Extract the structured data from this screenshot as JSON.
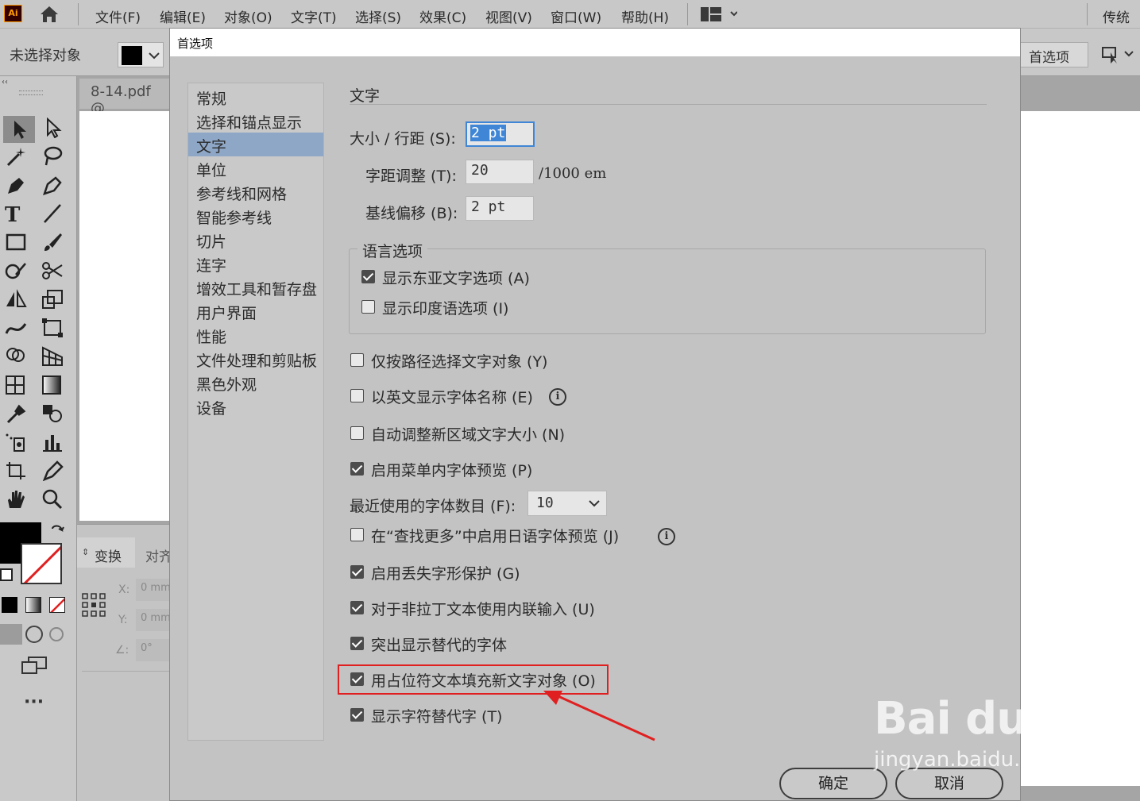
{
  "app": {
    "logo_text": "Ai",
    "menus": [
      "文件(F)",
      "编辑(E)",
      "对象(O)",
      "文字(T)",
      "选择(S)",
      "效果(C)",
      "视图(V)",
      "窗口(W)",
      "帮助(H)"
    ],
    "workspace": "传统基"
  },
  "control_bar": {
    "no_selection": "未选择对象",
    "prefs_button": "首选项"
  },
  "document": {
    "tab": "8-14.pdf @"
  },
  "panel": {
    "tab_transform": "变换",
    "tab_align": "对齐",
    "x_label": "X:",
    "y_label": "Y:",
    "angle_label": "∠:",
    "x_value": "0 mm",
    "y_value": "0 mm",
    "angle_value": "0°"
  },
  "dialog": {
    "title": "首选项",
    "sidebar": [
      "常规",
      "选择和锚点显示",
      "文字",
      "单位",
      "参考线和网格",
      "智能参考线",
      "切片",
      "连字",
      "增效工具和暂存盘",
      "用户界面",
      "性能",
      "文件处理和剪贴板",
      "黑色外观",
      "设备"
    ],
    "selected_index": 2,
    "section_title": "文字",
    "size_leading_label": "大小 / 行距 (S):",
    "size_leading_value": "2 pt",
    "tracking_label": "字距调整 (T):",
    "tracking_value": "20",
    "tracking_unit": "/1000 em",
    "baseline_label": "基线偏移 (B):",
    "baseline_value": "2 pt",
    "lang_group_title": "语言选项",
    "show_east_asian": "显示东亚文字选项 (A)",
    "show_east_asian_checked": true,
    "show_indic": "显示印度语选项 (I)",
    "show_indic_checked": false,
    "opt_path_select": "仅按路径选择文字对象 (Y)",
    "opt_english_names": "以英文显示字体名称 (E)",
    "opt_auto_size": "自动调整新区域文字大小 (N)",
    "opt_font_preview": "启用菜单内字体预览 (P)",
    "recent_fonts_label": "最近使用的字体数目 (F):",
    "recent_fonts_value": "10",
    "opt_japanese_preview": "在“查找更多”中启用日语字体预览 (J)",
    "opt_missing_glyph": "启用丢失字形保护 (G)",
    "opt_inline_input": "对于非拉丁文本使用内联输入 (U)",
    "opt_highlight_sub": "突出显示替代的字体",
    "opt_placeholder": "用占位符文本填充新文字对象 (O)",
    "opt_show_alternates": "显示字符替代字 (T)",
    "ok": "确定",
    "cancel": "取消",
    "info_glyph": "i"
  },
  "checks": {
    "path_select": false,
    "english_names": false,
    "auto_size": false,
    "font_preview": true,
    "japanese_preview": false,
    "missing_glyph": true,
    "inline_input": true,
    "highlight_sub": true,
    "placeholder": true,
    "show_alternates": true
  },
  "watermark": {
    "brand": "Bai du 经验",
    "url": "jingyan.baidu.com"
  },
  "colors": {
    "selection": "#8ea7c7",
    "highlight_box": "#e02020",
    "focus_field": "#3f86d6"
  }
}
